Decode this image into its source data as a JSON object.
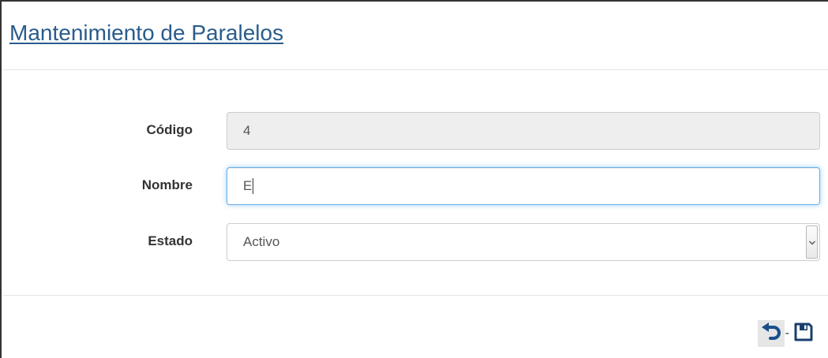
{
  "page": {
    "title": "Mantenimiento de Paralelos"
  },
  "form": {
    "codigo": {
      "label": "Código",
      "value": "4"
    },
    "nombre": {
      "label": "Nombre",
      "value": "E"
    },
    "estado": {
      "label": "Estado",
      "selected": "Activo"
    }
  },
  "actions": {
    "separator": "-",
    "undo_icon": "undo-icon",
    "save_icon": "floppy-save-icon"
  },
  "colors": {
    "title": "#2a5c8c",
    "focus_border": "#66afe9",
    "icon": "#1a3f6b"
  }
}
